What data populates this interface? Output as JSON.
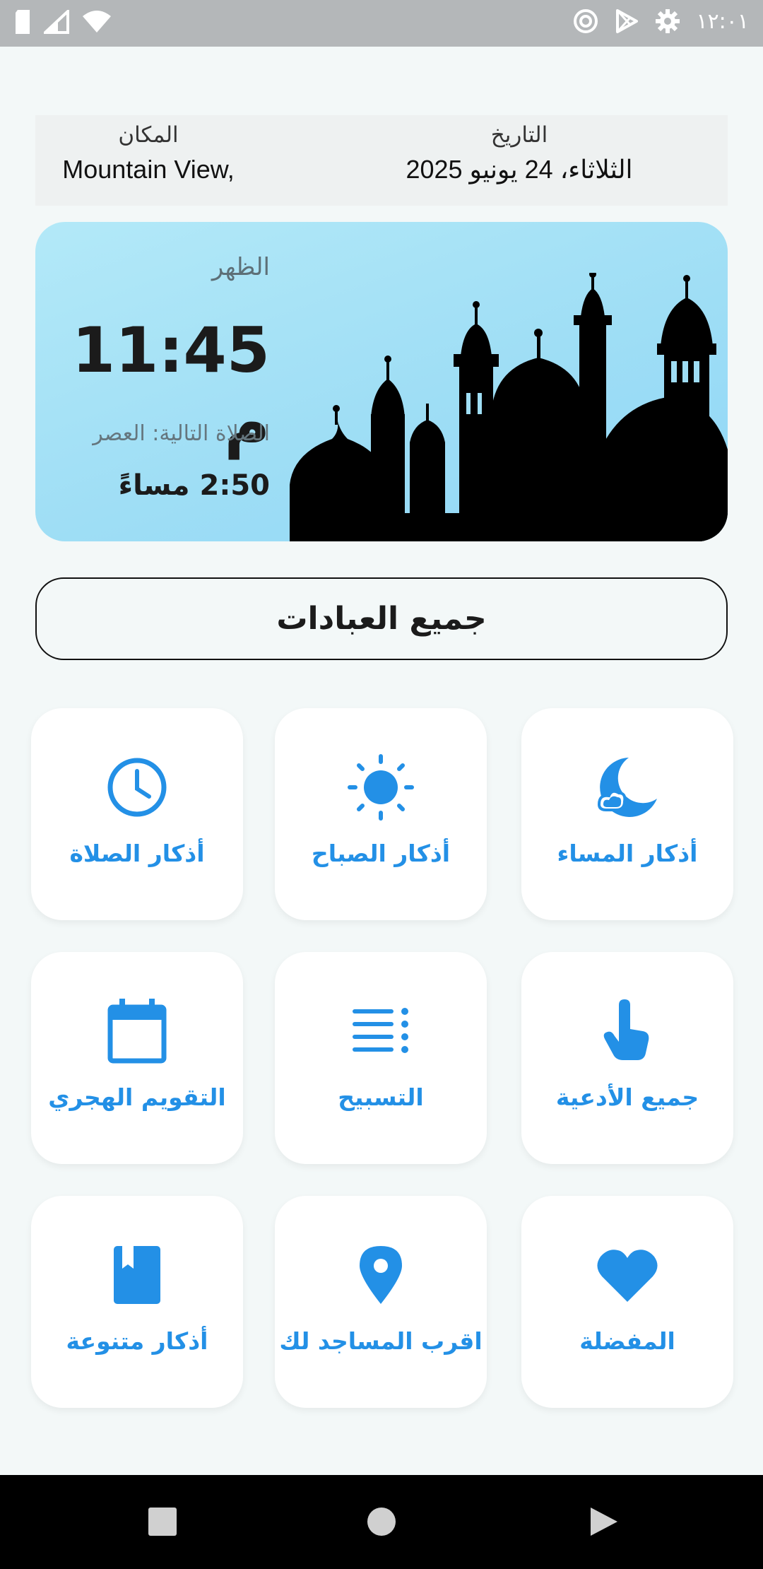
{
  "status_bar": {
    "time": "١٢:٠١",
    "left_icons": [
      "sd-card-icon",
      "signal-icon",
      "wifi-icon"
    ],
    "right_icons": [
      "sync-icon",
      "play-store-icon",
      "gear-icon"
    ]
  },
  "info": {
    "place_label": "المكان",
    "place_value": "Mountain View,",
    "date_label": "التاريخ",
    "date_value": "الثلاثاء، 24 يونيو 2025"
  },
  "prayer": {
    "current_name": "الظهر",
    "current_time": "11:45 م",
    "next_label": "الصلاة التالية: العصر",
    "next_time": "2:50 مساءً"
  },
  "all_worship_button": "جميع العبادات",
  "tiles": [
    {
      "label": "أذكار المساء",
      "icon": "moon-icon"
    },
    {
      "label": "أذكار الصباح",
      "icon": "sun-icon"
    },
    {
      "label": "أذكار الصلاة",
      "icon": "clock-icon"
    },
    {
      "label": "جميع الأدعية",
      "icon": "pointing-hand-icon"
    },
    {
      "label": "التسبيح",
      "icon": "list-icon"
    },
    {
      "label": "التقويم الهجري",
      "icon": "calendar-icon"
    },
    {
      "label": "المفضلة",
      "icon": "heart-icon"
    },
    {
      "label": "اقرب المساجد لك",
      "icon": "location-pin-icon"
    },
    {
      "label": "أذكار متنوعة",
      "icon": "book-icon"
    }
  ],
  "colors": {
    "accent": "#2390e6",
    "status_bar": "#b4b7b9",
    "card_gradient_start": "#b3e9f8",
    "card_gradient_end": "#90d7f7"
  },
  "nav_bar": [
    "recents-button",
    "home-button",
    "back-button"
  ]
}
